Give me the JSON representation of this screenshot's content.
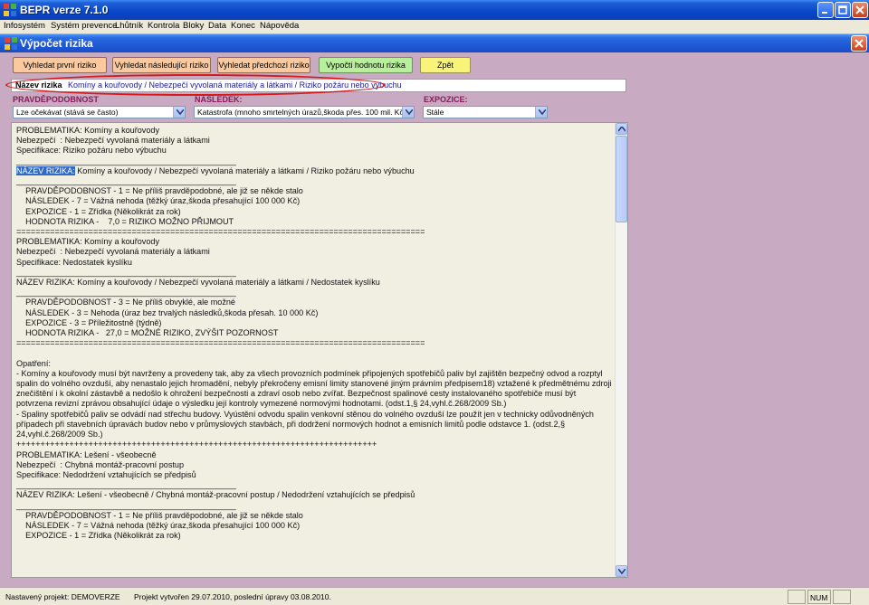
{
  "app": {
    "title": "BEPR verze 7.1.0",
    "menu": [
      "Infosystém",
      "Systém prevence",
      "Lhůtník",
      "Kontrola",
      "Bloky",
      "Data",
      "Konec",
      "Nápověda"
    ]
  },
  "window": {
    "title": "Výpočet rizika"
  },
  "buttons": {
    "first": "Vyhledat první riziko",
    "next": "Vyhledat následující riziko",
    "prev": "Vyhledat předchozí riziko",
    "compute": "Vypočti hodnotu rizika",
    "back": "Zpět"
  },
  "risk_name": {
    "label": "Název rizika",
    "value": "Komíny a kouřovody / Nebezpečí vyvolaná materiály a látkami / Riziko požáru nebo výbuchu"
  },
  "fields": {
    "probability": {
      "label": "PRAVDĚPODOBNOST",
      "value": "Lze očekávat (stává se často)"
    },
    "consequence": {
      "label": "NÁSLEDEK:",
      "value": "Katastrofa (mnoho smrtelných úrazů,škoda přes. 100 mil. Kč)"
    },
    "exposure": {
      "label": "EXPOZICE:",
      "value": "Stále"
    }
  },
  "text": {
    "block1": "PROBLEMATIKA: Komíny a kouřovody\nNebezpečí  : Nebezpečí vyvolaná materiály a látkami\nSpecifikace: Riziko požáru nebo výbuchu\n________________________________________________",
    "hl_label": "NÁZEV RIZIKA:",
    "hl_rest": " Komíny a kouřovody / Nebezpečí vyvolaná materiály a látkami / Riziko požáru nebo výbuchu",
    "block2": "________________________________________________\n    PRAVDĚPODOBNOST - 1 = Ne příliš pravděpodobné, ale již se někde stalo\n    NÁSLEDEK - 7 = Vážná nehoda (těžký úraz,škoda přesahující 100 000 Kč)\n    EXPOZICE - 1 = Zřídka (Několikrát za rok)\n    HODNOTA RIZIKA -    7,0 = RIZIKO MOŽNO PŘIJMOUT\n=====================================================================================\nPROBLEMATIKA: Komíny a kouřovody\nNebezpečí  : Nebezpečí vyvolaná materiály a látkami\nSpecifikace: Nedostatek kyslíku\n________________________________________________\nNÁZEV RIZIKA: Komíny a kouřovody / Nebezpečí vyvolaná materiály a látkami / Nedostatek kyslíku\n________________________________________________\n    PRAVDĚPODOBNOST - 3 = Ne příliš obvyklé, ale možné\n    NÁSLEDEK - 3 = Nehoda (úraz bez trvalých následků,škoda přesah. 10 000 Kč)\n    EXPOZICE - 3 = Příležitostně (týdně)\n    HODNOTA RIZIKA -   27,0 = MOŽNÉ RIZIKO, ZVÝŠIT POZORNOST\n=====================================================================================\n\nOpatření:\n- Komíny a kouřovody musí být navrženy a provedeny tak, aby za všech provozních podmínek připojených spotřebičů paliv byl zajištěn bezpečný odvod a rozptyl spalin do volného ovzduší, aby nenastalo jejich hromadění, nebyly překročeny emisní limity stanovené jiným právním předpisem18) vztažené k předmětnému zdroji znečištění i k okolní zástavbě a nedošlo k ohrožení bezpečnosti a zdraví osob nebo zvířat. Bezpečnost spalinové cesty instalovaného spotřebiče musí být potvrzena revizní zprávou obsahující údaje o výsledku její kontroly vymezené normovými hodnotami. (odst.1,§ 24,vyhl.č.268/2009 Sb.)\n- Spaliny spotřebičů paliv se odvádí nad střechu budovy. Vyústění odvodu spalin venkovní stěnou do volného ovzduší lze použít jen v technicky odůvodněných případech při stavebních úpravách budov nebo v průmyslových stavbách, při dodržení normových hodnot a emisních limitů podle odstavce 1. (odst.2,§ 24,vyhl.č.268/2009 Sb.)\n+++++++++++++++++++++++++++++++++++++++++++++++++++++++++++++++++++++++++++\nPROBLEMATIKA: Lešení - všeobecně\nNebezpečí  : Chybná montáž-pracovní postup\nSpecifikace: Nedodržení vztahujících se předpisů\n________________________________________________\nNÁZEV RIZIKA: Lešení - všeobecně / Chybná montáž-pracovní postup / Nedodržení vztahujících se předpisů\n________________________________________________\n    PRAVDĚPODOBNOST - 1 = Ne příliš pravděpodobné, ale již se někde stalo\n    NÁSLEDEK - 7 = Vážná nehoda (těžký úraz,škoda přesahující 100 000 Kč)\n    EXPOZICE - 1 = Zřídka (Několikrát za rok)"
  },
  "status": {
    "project": "Nastavený projekt: DEMOVERZE",
    "created": "Projekt vytvořen 29.07.2010, poslední úpravy 03.08.2010.",
    "num": "NUM"
  }
}
